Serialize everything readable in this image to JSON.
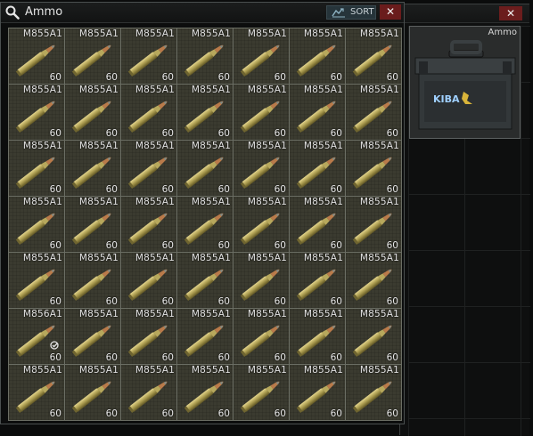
{
  "stash_window": {
    "title": "Ammo",
    "sort_label": "SORT",
    "close_label": "✕"
  },
  "container_window": {
    "close_label": "✕",
    "item": {
      "name": "Ammo",
      "logo_text": "KIBA"
    }
  },
  "grid": {
    "columns": 7,
    "rows": [
      [
        "M855A1",
        "M855A1",
        "M855A1",
        "M855A1",
        "M855A1",
        "M855A1",
        "M855A1"
      ],
      [
        "M855A1",
        "M855A1",
        "M855A1",
        "M855A1",
        "M855A1",
        "M855A1",
        "M855A1"
      ],
      [
        "M855A1",
        "M855A1",
        "M855A1",
        "M855A1",
        "M855A1",
        "M855A1",
        "M855A1"
      ],
      [
        "M855A1",
        "M855A1",
        "M855A1",
        "M855A1",
        "M855A1",
        "M855A1",
        "M855A1"
      ],
      [
        "M855A1",
        "M855A1",
        "M855A1",
        "M855A1",
        "M855A1",
        "M855A1",
        "M855A1"
      ],
      [
        "M856A1",
        "M855A1",
        "M855A1",
        "M855A1",
        "M855A1",
        "M855A1",
        "M855A1"
      ],
      [
        "M855A1",
        "M855A1",
        "M855A1",
        "M855A1",
        "M855A1",
        "M855A1",
        "M855A1"
      ]
    ],
    "count": "60",
    "checked_cell": {
      "row": 5,
      "col": 0
    }
  },
  "colors": {
    "cell_bg": "#3b3b30",
    "close_red": "#6a1c1c",
    "sort_bg": "#26343a"
  }
}
